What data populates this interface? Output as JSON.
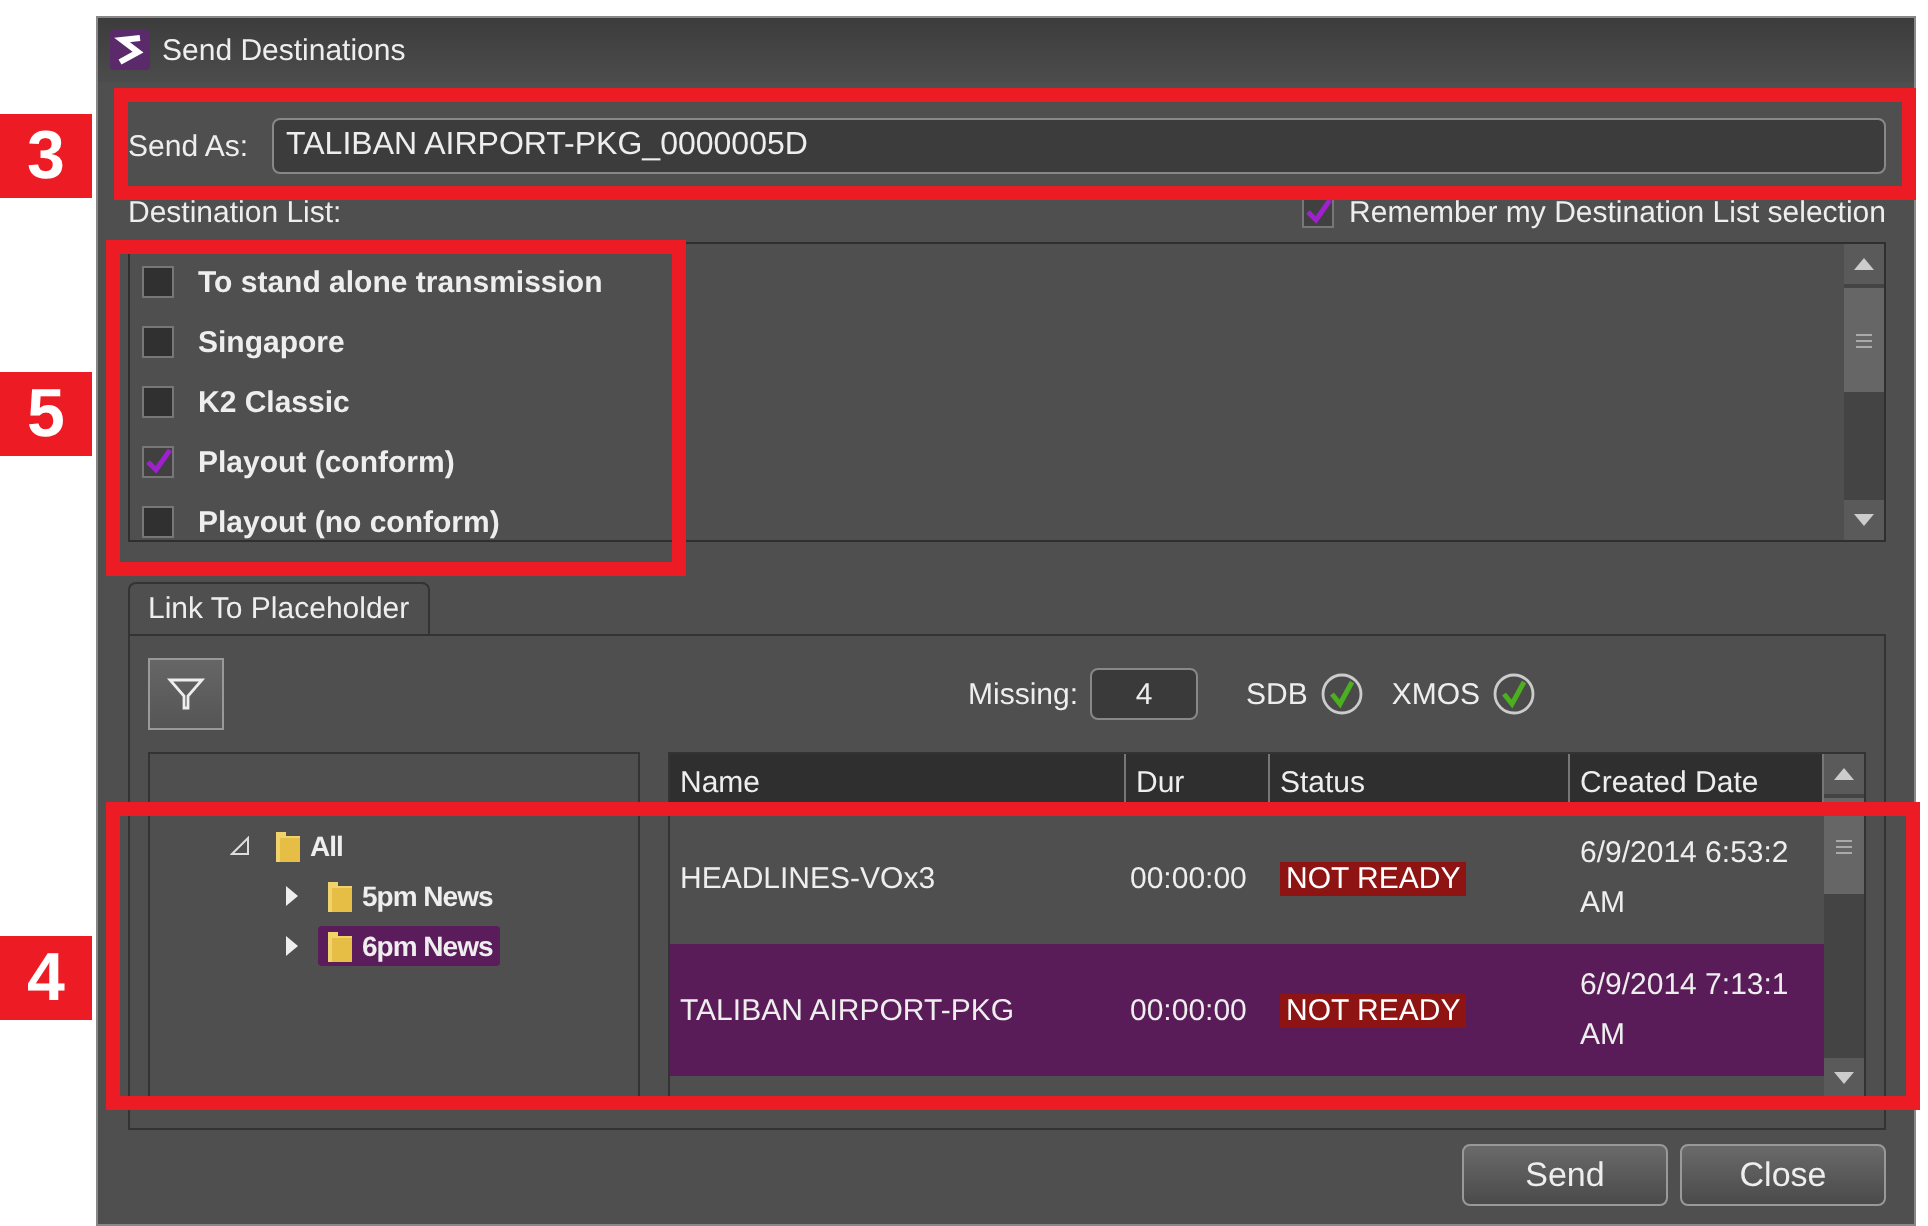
{
  "window": {
    "title": "Send Destinations"
  },
  "send_as": {
    "label": "Send As:",
    "value": "TALIBAN AIRPORT-PKG_0000005D"
  },
  "destination_list": {
    "label": "Destination List:",
    "remember": {
      "label": "Remember my Destination List selection",
      "checked": true
    },
    "items": [
      {
        "label": "To stand alone transmission",
        "checked": false
      },
      {
        "label": "Singapore",
        "checked": false
      },
      {
        "label": "K2 Classic",
        "checked": false
      },
      {
        "label": "Playout (conform)",
        "checked": true
      },
      {
        "label": "Playout (no conform)",
        "checked": false
      }
    ]
  },
  "tabs": [
    {
      "label": "Link To Placeholder",
      "selected": true
    }
  ],
  "missing": {
    "label": "Missing:",
    "value": "4"
  },
  "indicators": [
    {
      "label": "SDB",
      "ok": true
    },
    {
      "label": "XMOS",
      "ok": true
    }
  ],
  "tree": [
    {
      "label": "All",
      "kind": "folder",
      "expanded": true,
      "selected": false,
      "children": [
        {
          "label": "5pm News",
          "kind": "folder",
          "expanded": false,
          "selected": false
        },
        {
          "label": "6pm News",
          "kind": "folder",
          "expanded": false,
          "selected": true
        }
      ]
    }
  ],
  "table": {
    "columns": [
      "Name",
      "Dur",
      "Status",
      "Created Date"
    ],
    "rows": [
      {
        "name": "HEADLINES-VOx3",
        "dur": "00:00:00",
        "status": "NOT READY",
        "created": [
          "6/9/2014 6:53:2",
          "AM"
        ],
        "selected": false
      },
      {
        "name": "TALIBAN AIRPORT-PKG",
        "dur": "00:00:00",
        "status": "NOT READY",
        "created": [
          "6/9/2014 7:13:1",
          "AM"
        ],
        "selected": true
      }
    ]
  },
  "buttons": [
    "Send",
    "Close"
  ],
  "annotations": [
    {
      "number": "3"
    },
    {
      "number": "5"
    },
    {
      "number": "4"
    }
  ]
}
